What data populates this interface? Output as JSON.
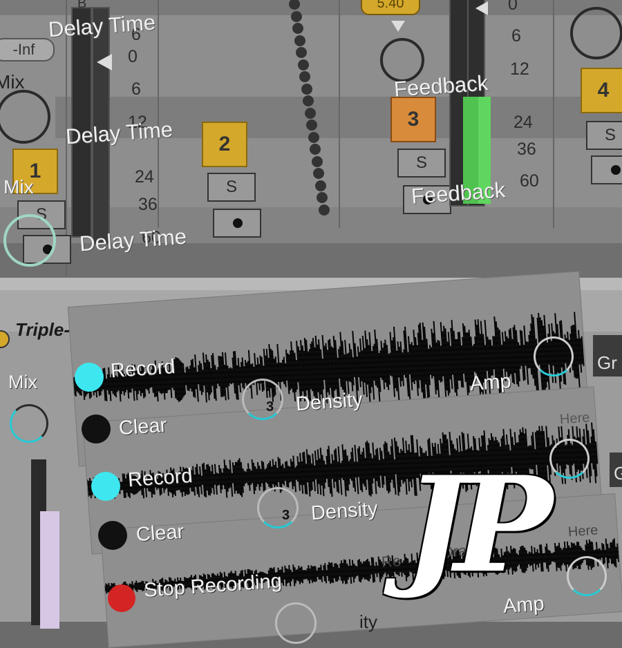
{
  "mixer": {
    "delay_time_label": "Delay Time",
    "feedback_label": "Feedback",
    "mix_label": "Mix",
    "inf_label": "-Inf",
    "top_value_label": "5.40",
    "scale": [
      "0",
      "6",
      "12",
      "24",
      "36",
      "60"
    ],
    "scale_right": [
      "0",
      "6",
      "12",
      "24",
      "36",
      "60"
    ],
    "top_marks": [
      "B",
      "6"
    ],
    "tracks": [
      "1",
      "2",
      "3",
      "4"
    ],
    "solo_label": "S"
  },
  "device": {
    "title": "Triple-Perc",
    "hand_icon": "hand-icon",
    "mix_label": "Mix",
    "record_label": "Record",
    "clear_label": "Clear",
    "density_label": "Density",
    "density_value": "3",
    "amp_label": "Amp",
    "stop_recording_label": "Stop Recording",
    "drag_here_label": "Here",
    "drag_partial": "Drag",
    "rec_partial": "Re",
    "gr_label": "Gr",
    "gr_label_2": "G",
    "partial_text": "ity",
    "watermark": "JP",
    "colors": {
      "record": "#3ee7ef",
      "stop": "#d42424",
      "knob_arc": "#27c9d4",
      "track": "#d4a82a",
      "track3": "#d88b3b",
      "meter_green": "#4fc24f"
    }
  }
}
